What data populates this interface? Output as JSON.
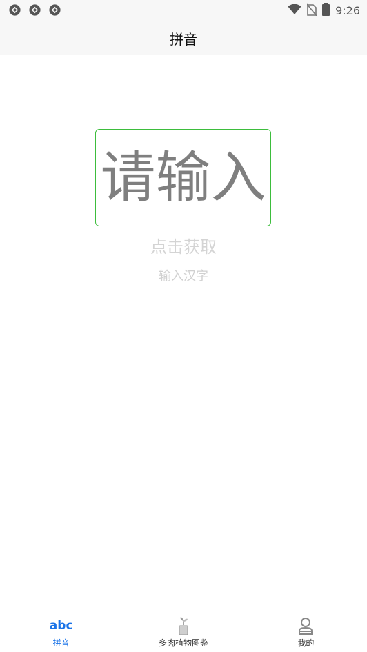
{
  "status_bar": {
    "time": "9:26",
    "left_icons": [
      "app-notification-icon",
      "app-notification-icon",
      "app-notification-icon"
    ],
    "right_icons": [
      "wifi-icon",
      "no-sim-icon",
      "battery-icon"
    ]
  },
  "header": {
    "title": "拼音"
  },
  "main": {
    "input_text": "请输入",
    "tap_hint": "点击获取",
    "sub_hint": "输入汉字"
  },
  "bottom_nav": {
    "items": [
      {
        "icon_text": "abc",
        "label": "拼音",
        "active": true
      },
      {
        "icon": "plant-pot-icon",
        "label": "多肉植物图鉴",
        "active": false
      },
      {
        "icon": "user-icon",
        "label": "我的",
        "active": false
      }
    ],
    "active_color": "#1a73e8"
  },
  "colors": {
    "input_border": "#3dbd3d",
    "input_text": "#7f7f7f",
    "hint_text": "#d4d4d4"
  }
}
